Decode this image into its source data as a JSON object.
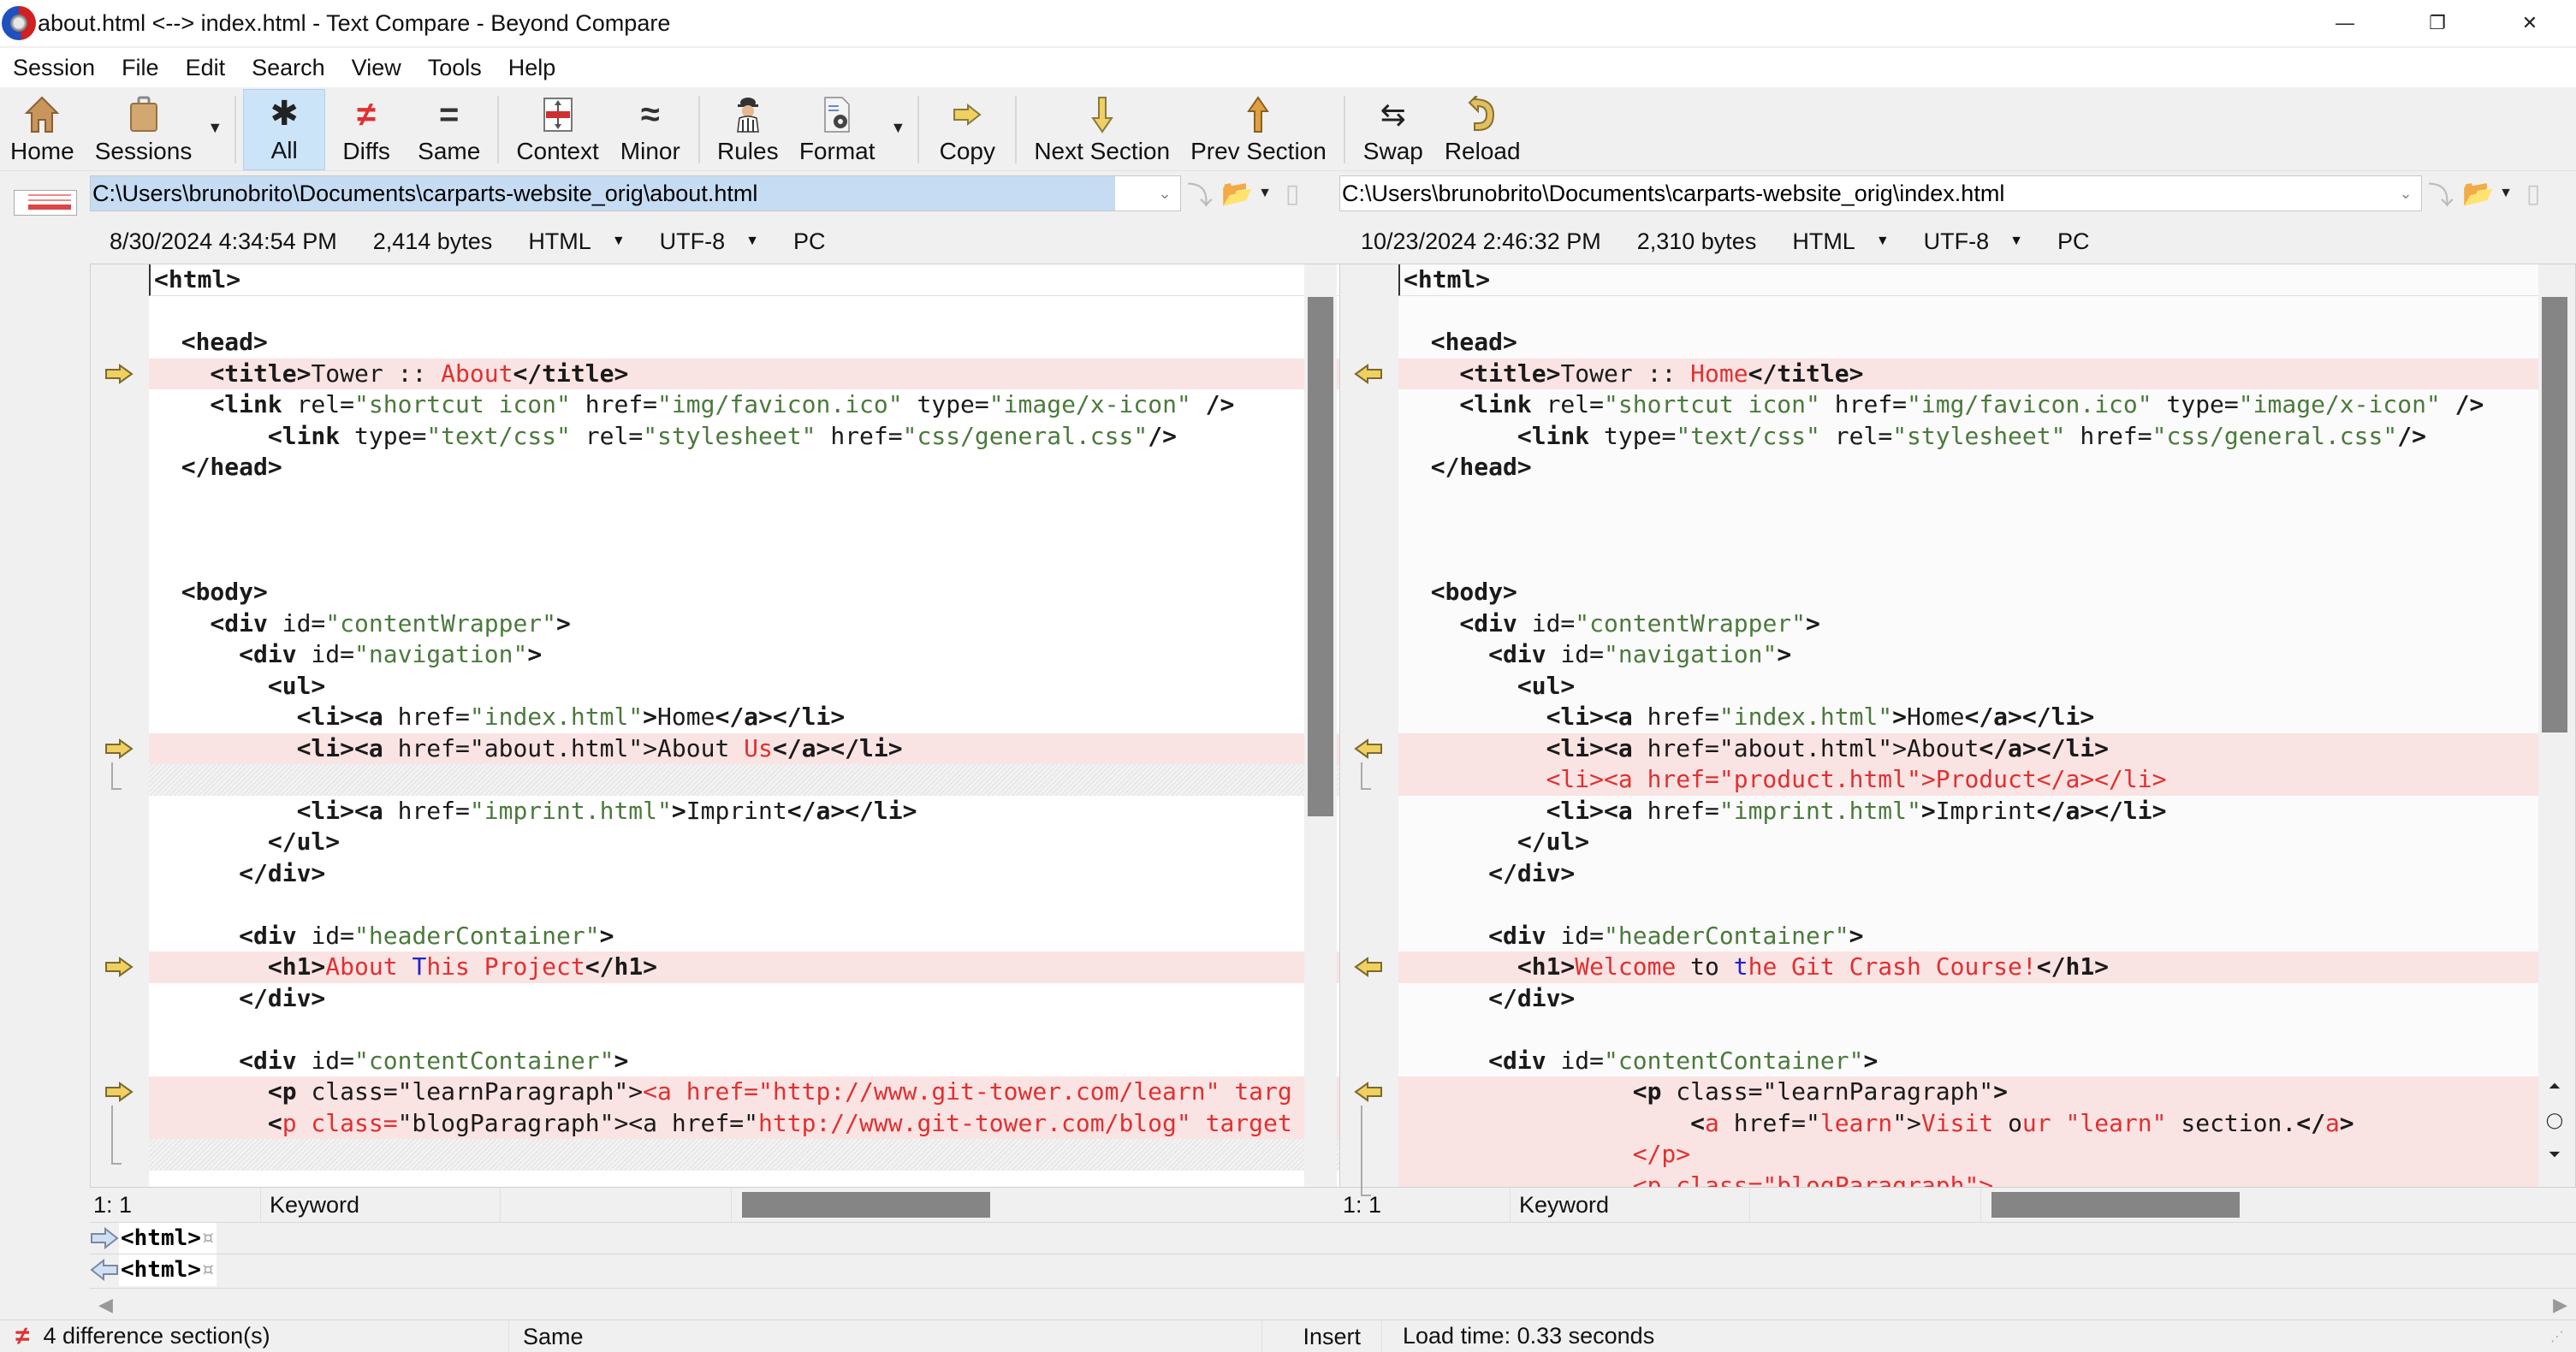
{
  "window": {
    "title": "about.html <--> index.html - Text Compare - Beyond Compare",
    "controls": {
      "minimize": "—",
      "restore": "❐",
      "close": "✕"
    }
  },
  "menu": [
    "Session",
    "File",
    "Edit",
    "Search",
    "View",
    "Tools",
    "Help"
  ],
  "toolbar": {
    "home": "Home",
    "sessions": "Sessions",
    "all": "All",
    "diffs": "Diffs",
    "same": "Same",
    "context": "Context",
    "minor": "Minor",
    "rules": "Rules",
    "format": "Format",
    "copy": "Copy",
    "next_section": "Next Section",
    "prev_section": "Prev Section",
    "swap": "Swap",
    "reload": "Reload",
    "active_filter": "All",
    "colors": {
      "diff": "#e03030",
      "arrow": "#e8c850",
      "accent": "#cce4f7"
    }
  },
  "left": {
    "path": "C:\\Users\\brunobrito\\Documents\\carparts-website_orig\\about.html",
    "date": "8/30/2024 4:34:54 PM",
    "size": "2,414 bytes",
    "format": "HTML",
    "encoding": "UTF-8",
    "line_endings": "PC",
    "cursor": "1: 1",
    "token": "Keyword"
  },
  "right": {
    "path": "C:\\Users\\brunobrito\\Documents\\carparts-website_orig\\index.html",
    "date": "10/23/2024 2:46:32 PM",
    "size": "2,310 bytes",
    "format": "HTML",
    "encoding": "UTF-8",
    "line_endings": "PC",
    "cursor": "1: 1",
    "token": "Keyword"
  },
  "left_lines": [
    {
      "type": "first",
      "segs": [
        [
          "",
          "<html>"
        ]
      ]
    },
    {
      "type": "blank",
      "segs": []
    },
    {
      "type": "same",
      "segs": [
        [
          "",
          "  <head>"
        ]
      ]
    },
    {
      "type": "diff",
      "marker": true,
      "segs": [
        [
          "",
          "    <title>"
        ],
        [
          "n",
          "Tower :: "
        ],
        [
          "r",
          "About"
        ],
        [
          "",
          "</title>"
        ]
      ]
    },
    {
      "type": "same",
      "segs": [
        [
          "",
          "    <link "
        ],
        [
          "n",
          "rel="
        ],
        [
          "a",
          "\"shortcut icon\""
        ],
        [
          "n",
          " href="
        ],
        [
          "a",
          "\"img/favicon.ico\""
        ],
        [
          "n",
          " type="
        ],
        [
          "a",
          "\"image/x-icon\""
        ],
        [
          "",
          " />"
        ]
      ]
    },
    {
      "type": "same",
      "segs": [
        [
          "",
          "        <link "
        ],
        [
          "n",
          "type="
        ],
        [
          "a",
          "\"text/css\""
        ],
        [
          "n",
          " rel="
        ],
        [
          "a",
          "\"stylesheet\""
        ],
        [
          "n",
          " href="
        ],
        [
          "a",
          "\"css/general.css\""
        ],
        [
          "",
          "/>"
        ]
      ]
    },
    {
      "type": "same",
      "segs": [
        [
          "",
          "  </head>"
        ]
      ]
    },
    {
      "type": "blank",
      "segs": []
    },
    {
      "type": "blank",
      "segs": []
    },
    {
      "type": "blank",
      "segs": []
    },
    {
      "type": "same",
      "segs": [
        [
          "",
          "  <body>"
        ]
      ]
    },
    {
      "type": "same",
      "segs": [
        [
          "",
          "    <div "
        ],
        [
          "n",
          "id="
        ],
        [
          "a",
          "\"contentWrapper\""
        ],
        [
          "",
          ">"
        ]
      ]
    },
    {
      "type": "same",
      "segs": [
        [
          "",
          "      <div "
        ],
        [
          "n",
          "id="
        ],
        [
          "a",
          "\"navigation\""
        ],
        [
          "",
          ">"
        ]
      ]
    },
    {
      "type": "same",
      "segs": [
        [
          "",
          "        <ul>"
        ]
      ]
    },
    {
      "type": "same",
      "segs": [
        [
          "",
          "          <li><a "
        ],
        [
          "n",
          "href="
        ],
        [
          "a",
          "\"index.html\""
        ],
        [
          "",
          ">"
        ],
        [
          "n",
          "Home"
        ],
        [
          "",
          "</a></li>"
        ]
      ]
    },
    {
      "type": "diff",
      "marker": true,
      "segs": [
        [
          "",
          "          <li><a "
        ],
        [
          "n",
          "href=\"about.html\">About "
        ],
        [
          "r",
          "Us"
        ],
        [
          "",
          "</a></li>"
        ]
      ]
    },
    {
      "type": "hatch",
      "segs": []
    },
    {
      "type": "same",
      "segs": [
        [
          "",
          "          <li><a "
        ],
        [
          "n",
          "href="
        ],
        [
          "a",
          "\"imprint.html\""
        ],
        [
          "",
          ">"
        ],
        [
          "n",
          "Imprint"
        ],
        [
          "",
          "</a></li>"
        ]
      ]
    },
    {
      "type": "same",
      "segs": [
        [
          "",
          "        </ul>"
        ]
      ]
    },
    {
      "type": "same",
      "segs": [
        [
          "",
          "      </div>"
        ]
      ]
    },
    {
      "type": "blank",
      "segs": []
    },
    {
      "type": "same",
      "segs": [
        [
          "",
          "      <div "
        ],
        [
          "n",
          "id="
        ],
        [
          "a",
          "\"headerContainer\""
        ],
        [
          "",
          ">"
        ]
      ]
    },
    {
      "type": "diff",
      "marker": true,
      "segs": [
        [
          "",
          "        <h1>"
        ],
        [
          "r",
          "About "
        ],
        [
          "b",
          "T"
        ],
        [
          "r",
          "his Project"
        ],
        [
          "",
          "</h1>"
        ]
      ]
    },
    {
      "type": "same",
      "segs": [
        [
          "",
          "      </div>"
        ]
      ]
    },
    {
      "type": "blank",
      "segs": []
    },
    {
      "type": "same",
      "segs": [
        [
          "",
          "      <div "
        ],
        [
          "n",
          "id="
        ],
        [
          "a",
          "\"contentContainer\""
        ],
        [
          "",
          ">"
        ]
      ]
    },
    {
      "type": "diff",
      "marker": true,
      "segs": [
        [
          "",
          "        <p "
        ],
        [
          "n",
          "class=\"learnParagraph\">"
        ],
        [
          "r",
          "<a href=\"http://www.git-tower.com/learn\" targ"
        ]
      ]
    },
    {
      "type": "diff",
      "segs": [
        [
          "",
          "        <"
        ],
        [
          "r",
          "p class="
        ],
        [
          "n",
          "\"blogParagraph\"><a href=\""
        ],
        [
          "r",
          "http://www.git-tower.com/blog\" target"
        ]
      ]
    },
    {
      "type": "hatch",
      "segs": []
    }
  ],
  "right_lines": [
    {
      "type": "first",
      "segs": [
        [
          "",
          "<html>"
        ]
      ]
    },
    {
      "type": "blank",
      "segs": []
    },
    {
      "type": "same",
      "segs": [
        [
          "",
          "  <head>"
        ]
      ]
    },
    {
      "type": "diff",
      "marker": true,
      "segs": [
        [
          "",
          "    <title>"
        ],
        [
          "n",
          "Tower :: "
        ],
        [
          "r",
          "Home"
        ],
        [
          "",
          "</title>"
        ]
      ]
    },
    {
      "type": "same",
      "segs": [
        [
          "",
          "    <link "
        ],
        [
          "n",
          "rel="
        ],
        [
          "a",
          "\"shortcut icon\""
        ],
        [
          "n",
          " href="
        ],
        [
          "a",
          "\"img/favicon.ico\""
        ],
        [
          "n",
          " type="
        ],
        [
          "a",
          "\"image/x-icon\""
        ],
        [
          "",
          " />"
        ]
      ]
    },
    {
      "type": "same",
      "segs": [
        [
          "",
          "        <link "
        ],
        [
          "n",
          "type="
        ],
        [
          "a",
          "\"text/css\""
        ],
        [
          "n",
          " rel="
        ],
        [
          "a",
          "\"stylesheet\""
        ],
        [
          "n",
          " href="
        ],
        [
          "a",
          "\"css/general.css\""
        ],
        [
          "",
          "/>"
        ]
      ]
    },
    {
      "type": "same",
      "segs": [
        [
          "",
          "  </head>"
        ]
      ]
    },
    {
      "type": "blank",
      "segs": []
    },
    {
      "type": "blank",
      "segs": []
    },
    {
      "type": "blank",
      "segs": []
    },
    {
      "type": "same",
      "segs": [
        [
          "",
          "  <body>"
        ]
      ]
    },
    {
      "type": "same",
      "segs": [
        [
          "",
          "    <div "
        ],
        [
          "n",
          "id="
        ],
        [
          "a",
          "\"contentWrapper\""
        ],
        [
          "",
          ">"
        ]
      ]
    },
    {
      "type": "same",
      "segs": [
        [
          "",
          "      <div "
        ],
        [
          "n",
          "id="
        ],
        [
          "a",
          "\"navigation\""
        ],
        [
          "",
          ">"
        ]
      ]
    },
    {
      "type": "same",
      "segs": [
        [
          "",
          "        <ul>"
        ]
      ]
    },
    {
      "type": "same",
      "segs": [
        [
          "",
          "          <li><a "
        ],
        [
          "n",
          "href="
        ],
        [
          "a",
          "\"index.html\""
        ],
        [
          "",
          ">"
        ],
        [
          "n",
          "Home"
        ],
        [
          "",
          "</a></li>"
        ]
      ]
    },
    {
      "type": "diff",
      "marker": true,
      "segs": [
        [
          "",
          "          <li><a "
        ],
        [
          "n",
          "href=\"about.html\">About"
        ],
        [
          "",
          "</a></li>"
        ]
      ]
    },
    {
      "type": "diff",
      "segs": [
        [
          "r",
          "          <li><a href=\"product.html\">Product</a></li>"
        ]
      ]
    },
    {
      "type": "same",
      "segs": [
        [
          "",
          "          <li><a "
        ],
        [
          "n",
          "href="
        ],
        [
          "a",
          "\"imprint.html\""
        ],
        [
          "",
          ">"
        ],
        [
          "n",
          "Imprint"
        ],
        [
          "",
          "</a></li>"
        ]
      ]
    },
    {
      "type": "same",
      "segs": [
        [
          "",
          "        </ul>"
        ]
      ]
    },
    {
      "type": "same",
      "segs": [
        [
          "",
          "      </div>"
        ]
      ]
    },
    {
      "type": "blank",
      "segs": []
    },
    {
      "type": "same",
      "segs": [
        [
          "",
          "      <div "
        ],
        [
          "n",
          "id="
        ],
        [
          "a",
          "\"headerContainer\""
        ],
        [
          "",
          ">"
        ]
      ]
    },
    {
      "type": "diff",
      "marker": true,
      "segs": [
        [
          "",
          "        <h1>"
        ],
        [
          "r",
          "Welcome "
        ],
        [
          "n",
          "to "
        ],
        [
          "b",
          "t"
        ],
        [
          "r",
          "he Git Crash Course!"
        ],
        [
          "",
          "</h1>"
        ]
      ]
    },
    {
      "type": "same",
      "segs": [
        [
          "",
          "      </div>"
        ]
      ]
    },
    {
      "type": "blank",
      "segs": []
    },
    {
      "type": "same",
      "segs": [
        [
          "",
          "      <div "
        ],
        [
          "n",
          "id="
        ],
        [
          "a",
          "\"contentContainer\""
        ],
        [
          "",
          ">"
        ]
      ]
    },
    {
      "type": "diff",
      "marker": true,
      "segs": [
        [
          "",
          "                <p "
        ],
        [
          "n",
          "class=\"learnParagraph\""
        ],
        [
          "",
          ">"
        ]
      ]
    },
    {
      "type": "diff",
      "segs": [
        [
          "",
          "                    <"
        ],
        [
          "r",
          "a"
        ],
        [
          "n",
          " href=\""
        ],
        [
          "r",
          "learn"
        ],
        [
          "n",
          "\">"
        ],
        [
          "r",
          "Visit "
        ],
        [
          "n",
          "o"
        ],
        [
          "r",
          "ur \"learn\" "
        ],
        [
          "n",
          "section."
        ],
        [
          "",
          "</"
        ],
        [
          "r",
          "a"
        ],
        [
          "",
          ">"
        ]
      ]
    },
    {
      "type": "diff",
      "segs": [
        [
          "r",
          "                </p>"
        ]
      ]
    },
    {
      "type": "diff",
      "segs": [
        [
          "r",
          "                <p class=\"blogParagraph\">"
        ]
      ]
    }
  ],
  "detail": {
    "left_line": "<html>",
    "right_line": "<html>",
    "eol_marker": "¤"
  },
  "scroll": {
    "left_vertical_fraction": 0.28,
    "right_vertical_fraction": 0.24
  },
  "status": {
    "diff_count": "4 difference section(s)",
    "mode": "Same",
    "insert": "Insert",
    "load_time": "Load time: 0.33 seconds"
  }
}
